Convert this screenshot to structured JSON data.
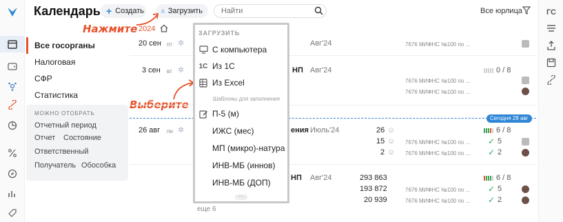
{
  "header": {
    "title": "Календарь",
    "create_label": "Создать",
    "upload_label": "Загрузить",
    "search_placeholder": "Найти",
    "all_legal_label": "Все юрлица"
  },
  "breadcrumb": {
    "year": "2024"
  },
  "hints": {
    "click": "Нажмите",
    "select": "Выберите"
  },
  "sidebar": {
    "items": [
      {
        "label": "Все госорганы",
        "active": true
      },
      {
        "label": "Налоговая"
      },
      {
        "label": "СФР"
      },
      {
        "label": "Статистика"
      }
    ],
    "filter_caption": "МОЖНО ОТОБРАТЬ",
    "filters": [
      "Отчетный период",
      "Отчет",
      "Состояние",
      "Ответственный",
      "Получатель",
      "Обособка"
    ]
  },
  "upload_menu": {
    "caption": "ЗАГРУЗИТЬ",
    "items": [
      {
        "label": "С компьютера",
        "icon": "monitor-icon"
      },
      {
        "label": "Из 1С",
        "icon": "1c-icon"
      },
      {
        "label": "Из Excel",
        "icon": "excel-icon"
      }
    ],
    "templates_caption": "Шаблоны для заполнения",
    "templates": [
      {
        "label": "П-5 (м)",
        "icon": "edit-form-icon"
      },
      {
        "label": "ИЖС (мес)"
      },
      {
        "label": "МП (микро)-натура"
      },
      {
        "label": "ИНВ-МБ (иннов)"
      },
      {
        "label": "ИНВ-МБ (ДОП)"
      }
    ]
  },
  "calendar": {
    "today_label": "Сегодня 28 авг",
    "more_label": "еще 6",
    "dates": [
      {
        "day": "20 сен",
        "weekday": "пт"
      },
      {
        "day": "3 сен",
        "weekday": "вт"
      },
      {
        "day": "26 авг",
        "weekday": "пн"
      }
    ],
    "fns_label": "7676 МИФНС №100 по ...",
    "rows": [
      {
        "tail": "",
        "period": "Авг'24"
      },
      {
        "tail": "НП",
        "period": "Авг'24",
        "progress": "0 / 8"
      },
      {
        "tail": "ения",
        "period": "Июль'24",
        "counts": [
          "26",
          "15",
          "2"
        ],
        "progress": "6 / 8",
        "done": [
          "5",
          "2"
        ]
      },
      {
        "tail": "НП",
        "period": "Авг'24",
        "amounts": [
          "293 863",
          "193 872",
          "20 939"
        ],
        "progress": "6 / 8",
        "done": [
          "5",
          "2"
        ]
      }
    ]
  },
  "colors": {
    "accent": "#e5522b",
    "today": "#2f86d6",
    "done": "#3aa55a"
  }
}
